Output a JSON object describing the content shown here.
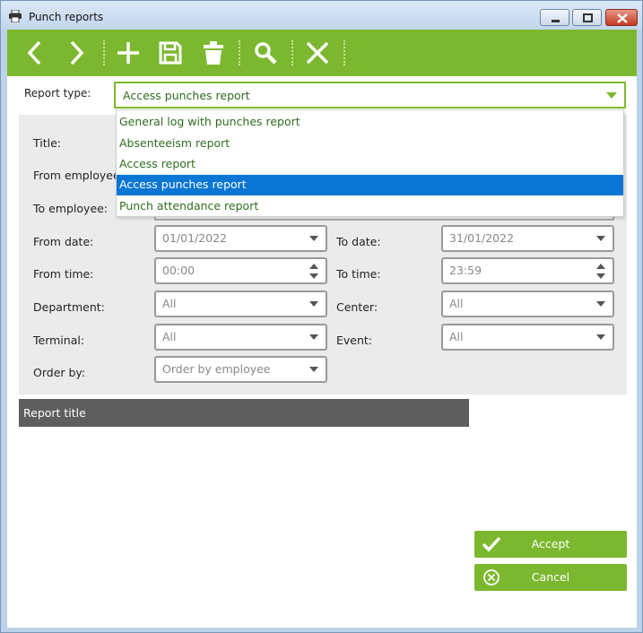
{
  "window": {
    "title": "Punch reports",
    "icons": [
      "printer-icon",
      "minimize-icon",
      "maximize-icon",
      "close-icon"
    ]
  },
  "toolbar": {
    "buttons": [
      "back-icon",
      "forward-icon",
      "add-icon",
      "save-icon",
      "delete-icon",
      "search-icon",
      "cancel-icon"
    ],
    "accent": "#7cb82f"
  },
  "report_type": {
    "label": "Report type:",
    "value": "Access punches report",
    "options": [
      "General log with punches report",
      "Absenteeism report",
      "Access report",
      "Access punches report",
      "Punch attendance report"
    ],
    "selected_index": 3
  },
  "form": {
    "title_label": "Title:",
    "from_employee_label": "From employee",
    "to_employee_label": "To employee:",
    "from_date_label": "From date:",
    "from_date_value": "01/01/2022",
    "to_date_label": "To date:",
    "to_date_value": "31/01/2022",
    "from_time_label": "From time:",
    "from_time_value": "00:00",
    "to_time_label": "To time:",
    "to_time_value": "23:59",
    "department_label": "Department:",
    "department_value": "All",
    "center_label": "Center:",
    "center_value": "All",
    "terminal_label": "Terminal:",
    "terminal_value": "All",
    "event_label": "Event:",
    "event_value": "All",
    "order_by_label": "Order by:",
    "order_by_value": "Order by employee"
  },
  "report_title_bar": "Report title",
  "actions": {
    "accept": "Accept",
    "cancel": "Cancel"
  },
  "colors": {
    "green": "#7cb82f",
    "selection_blue": "#0a76d4",
    "panel_gray": "#ebebeb",
    "title_bar_dark": "#5e5e5e"
  }
}
